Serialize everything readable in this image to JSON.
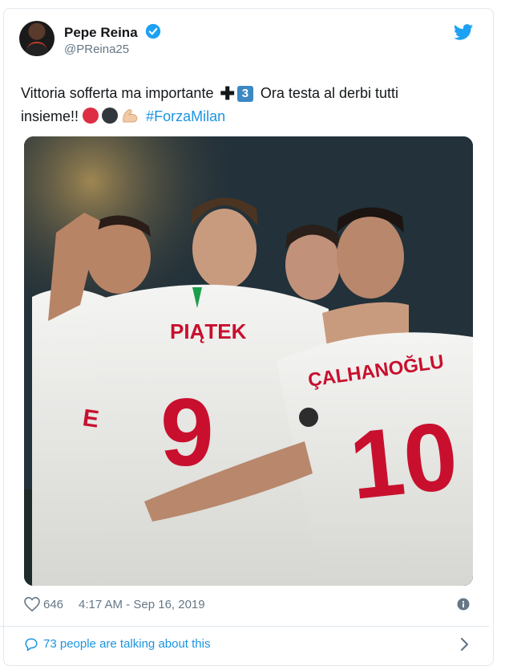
{
  "tweet": {
    "author_name": "Pepe Reina",
    "handle": "@PReina25",
    "text_line1_a": "Vittoria sofferta ma importante",
    "keycap_number": "3",
    "text_line1_b": "Ora testa al derbi tutti",
    "text_line2": "insieme!!",
    "hashtag": "#ForzaMilan",
    "likes": "646",
    "timestamp": "4:17 AM - Sep 16, 2019",
    "talking": "73 people are talking about this"
  },
  "photo": {
    "jersey_left_name": "PIĄTEK",
    "jersey_left_number": "9",
    "jersey_right_name": "ÇALHANOĞLU",
    "jersey_right_number": "10",
    "sponsor": "Emir"
  },
  "colors": {
    "accent": "#1b95e0",
    "verified": "#1da1f2",
    "muted": "#657786",
    "jersey_red": "#c8102e"
  },
  "icons": {
    "verified": "verified-badge-icon",
    "bird": "twitter-bird-icon",
    "heart": "heart-icon",
    "info": "info-icon",
    "bubble": "speech-bubble-icon",
    "chevron": "chevron-right-icon"
  }
}
